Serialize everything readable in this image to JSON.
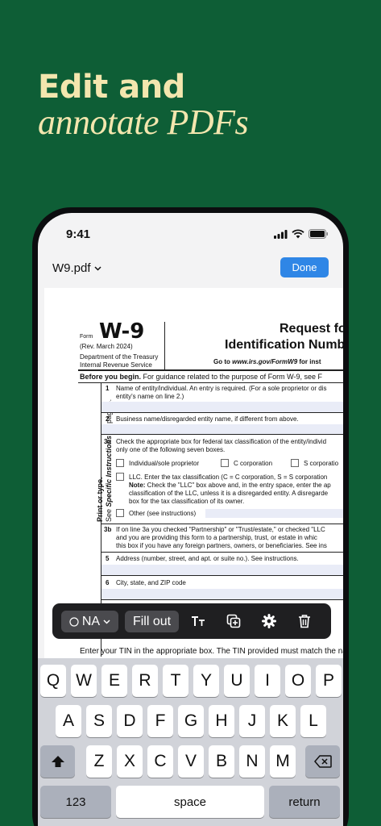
{
  "headline": {
    "line1": "Edit and",
    "line2": "annotate PDFs"
  },
  "status": {
    "time": "9:41"
  },
  "nav": {
    "filename": "W9.pdf",
    "done_label": "Done"
  },
  "form": {
    "form_label": "Form",
    "form_number": "W-9",
    "rev": "(Rev. March 2024)",
    "dept1": "Department of the Treasury",
    "dept2": "Internal Revenue Service",
    "title1": "Request fo",
    "title2": "Identification Numb",
    "goto_prefix": "Go to ",
    "goto_url": "www.irs.gov/FormW9",
    "goto_suffix": " for inst",
    "before_bold": "Before you begin.",
    "before_rest": " For guidance related to the purpose of Form W-9, see F",
    "line1_num": "1",
    "line1_a": "Name of entity/individual. An entry is required. (For a sole proprietor or dis",
    "line1_b": "entity's name on line 2.)",
    "line2_num": "2",
    "line2": "Business name/disregarded entity name, if different from above.",
    "line3a_num": "3a",
    "line3a_a": "Check the appropriate box for federal tax classification of the entity/individ",
    "line3a_b": "only one of the following seven boxes.",
    "opt_individual": "Individual/sole proprietor",
    "opt_ccorp": "C corporation",
    "opt_scorp": "S corporatio",
    "llc_a": "LLC. Enter the tax classification (C = C corporation, S = S corporation",
    "note_bold": "Note:",
    "note_a": " Check the \"LLC\" box above and, in the entry space, enter the ap",
    "note_b": "classification of the LLC, unless it is a disregarded entity. A disregarde",
    "note_c": "box for the tax classification of its owner.",
    "other": "Other (see instructions)",
    "line3b_num": "3b",
    "line3b_a": "If on line 3a you checked \"Partnership\" or \"Trust/estate,\" or checked \"LLC",
    "line3b_b": "and you are providing this form to a partnership, trust, or estate in whic",
    "line3b_c": "this box if you have any foreign partners, owners, or beneficiaries. See ins",
    "line5_num": "5",
    "line5": "Address (number, street, and apt. or suite no.). See instructions.",
    "line6_num": "6",
    "line6": "City, state, and ZIP code",
    "side1": "Print or type.",
    "side2_a": "See ",
    "side2_b": "Specific Instructions",
    "side2_c": " on page 3.",
    "tin": "Enter your TIN in the appropriate box. The TIN provided must match the na"
  },
  "toolbar": {
    "na_label": "NA",
    "fillout_label": "Fill out"
  },
  "keyboard": {
    "row1": [
      "Q",
      "W",
      "E",
      "R",
      "T",
      "Y",
      "U",
      "I",
      "O",
      "P"
    ],
    "row2": [
      "A",
      "S",
      "D",
      "F",
      "G",
      "H",
      "J",
      "K",
      "L"
    ],
    "row3": [
      "Z",
      "X",
      "C",
      "V",
      "B",
      "N",
      "M"
    ],
    "numbers_label": "123",
    "space_label": "space",
    "return_label": "return"
  }
}
